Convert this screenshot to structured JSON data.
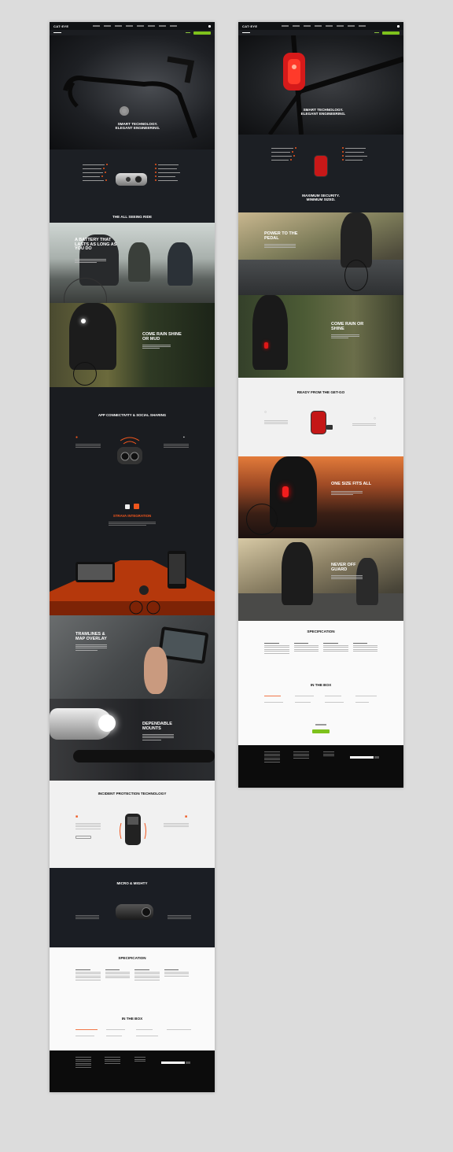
{
  "brand": {
    "logo": "CAT·EYE"
  },
  "colors": {
    "accent": "#7ec21c",
    "highlight": "#f0561d",
    "dark": "#1c1f24"
  },
  "left_page": {
    "hero_title": "SMART TECHNOLOGY.\nELEGANT ENGINEERING.",
    "features_title": "THE ALL SEEING RIDE",
    "battery_title": "A BATTERY THAT LASTS AS LONG AS YOU DO",
    "rain_title": "COME RAIN SHINE OR MUD",
    "app_title": "APP CONNECTIVITY & SOCIAL SHARING",
    "strava_title": "STRAVA INTEGRATION",
    "tramlines_title": "TRAMLINES & MAP OVERLAY",
    "mounts_title": "DEPENDABLE MOUNTS",
    "incident_title": "INCIDENT PROTECTION TECHNOLOGY",
    "micro_title": "MICRO & MIGHTY",
    "spec_title": "SPECIFICATION",
    "inbox_title": "IN THE BOX"
  },
  "right_page": {
    "hero_title": "SMART TECHNOLOGY.\nELEGANT ENGINEERING.",
    "features_title": "MAXIMUM SECURITY.\nMINIMUM SIZED.",
    "power_title": "POWER TO THE PEDAL",
    "rain_title": "COME RAIN OR SHINE",
    "ready_title": "READY FROM THE GET-GO",
    "fits_title": "ONE SIZE FITS ALL",
    "guard_title": "NEVER OFF GUARD",
    "spec_title": "SPECIFICATION",
    "inbox_title": "IN THE BOX"
  }
}
